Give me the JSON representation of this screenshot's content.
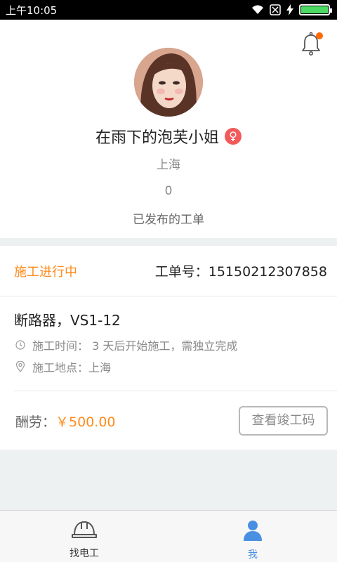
{
  "status_bar": {
    "time": "上午10:05",
    "icons": [
      "wifi-icon",
      "no-sim-icon",
      "charging-icon",
      "battery-icon"
    ],
    "battery_level": 1.0
  },
  "profile": {
    "name": "在雨下的泡芙小姐",
    "gender_symbol": "♀",
    "city": "上海",
    "published_count": "0",
    "published_label": "已发布的工单"
  },
  "order": {
    "status": "施工进行中",
    "order_number": "工单号：15150212307858",
    "title": "断路器，VS1-12",
    "time_info": "施工时间：  3 天后开始施工，需独立完成",
    "location_info": "施工地点：上海",
    "pay_label": "酬劳：",
    "pay_value": "￥500.00",
    "code_button": "查看竣工码"
  },
  "tabs": [
    {
      "label": "找电工",
      "icon": "hardhat-icon",
      "active": false
    },
    {
      "label": "我",
      "icon": "person-icon",
      "active": true
    }
  ],
  "colors": {
    "accent_orange": "#ff8a1a",
    "active_blue": "#4a90e2",
    "notification_dot": "#ff6a00",
    "gender_badge": "#f25b5b"
  }
}
